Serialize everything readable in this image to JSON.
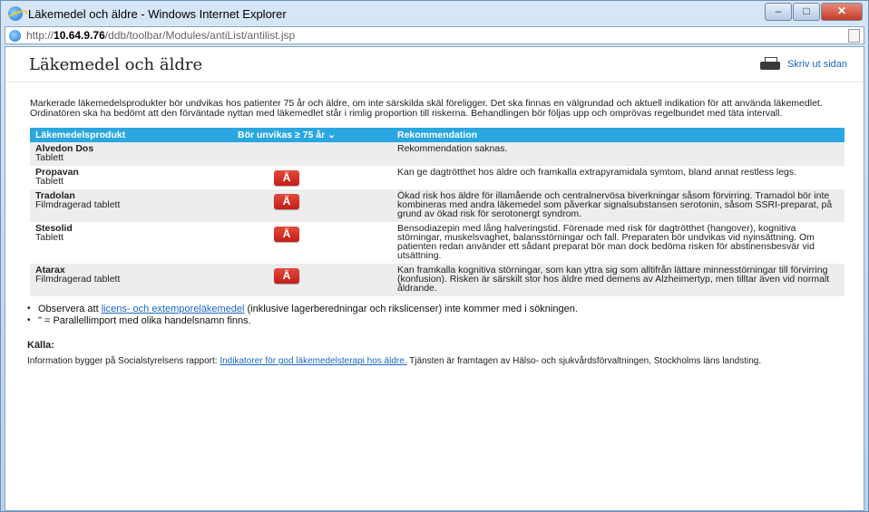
{
  "window": {
    "title": "Läkemedel och äldre - Windows Internet Explorer",
    "minimize": "–",
    "maximize": "□",
    "close": "✕"
  },
  "address": {
    "prefix": "http://",
    "host": "10.64.9.76",
    "path": "/ddb/toolbar/Modules/antiList/antilist.jsp"
  },
  "page": {
    "title": "Läkemedel och äldre",
    "print_label": "Skriv ut sidan",
    "intro": "Markerade läkemedelsprodukter bör undvikas hos patienter 75 år och äldre, om inte särskilda skäl föreligger. Det ska finnas en välgrundad och aktuell indikation för att använda läkemedlet. Ordinatören ska ha bedömt att den förväntade nyttan med läkemedlet står i rimlig proportion till riskerna. Behandlingen bör följas upp och omprövas regelbundet med täta intervall."
  },
  "table": {
    "headers": {
      "product": "Läkemedelsprodukt",
      "avoid": "Bör unvikas ≥ 75 år ⌄",
      "recommendation": "Rekommendation"
    },
    "warning_icon": "Ä",
    "rows": [
      {
        "name": "Alvedon Dos",
        "form": "Tablett",
        "avoid": false,
        "rec": "Rekommendation saknas."
      },
      {
        "name": "Propavan",
        "form": "Tablett",
        "avoid": true,
        "rec": "Kan ge dagtrötthet hos äldre och framkalla extrapyramidala symtom, bland annat restless legs."
      },
      {
        "name": "Tradolan",
        "form": "Filmdragerad tablett",
        "avoid": true,
        "rec": "Ökad risk hos äldre för illamående och centralnervösa biverkningar såsom förvirring. Tramadol bör inte kombineras med andra läkemedel som påverkar signalsubstansen serotonin, såsom SSRI-preparat, på grund av ökad risk för serotonergt syndrom."
      },
      {
        "name": "Stesolid",
        "form": "Tablett",
        "avoid": true,
        "rec": "Bensodiazepin med lång halveringstid. Förenade med risk för dagtrötthet (hangover), kognitiva störningar, muskelsvaghet, balansstörningar och fall. Preparaten bör undvikas vid nyinsättning. Om patienten redan använder ett sådant preparat bör man dock bedöma risken för abstinensbesvär vid utsättning."
      },
      {
        "name": "Atarax",
        "form": "Filmdragerad tablett",
        "avoid": true,
        "rec": "Kan framkalla kognitiva störningar, som kan yttra sig som alltifrån lättare minnesstörningar till förvirring (konfusion). Risken är särskilt stor hos äldre med demens av Alzheimertyp, men tilltar även vid normalt åldrande."
      }
    ]
  },
  "notes": {
    "note1_pre": "Observera att ",
    "note1_link": "licens- och extemporeläkemedel",
    "note1_post": " (inklusive lagerberedningar och rikslicenser) inte kommer med i sökningen.",
    "note2": "\" = Parallellimport med olika handelsnamn finns."
  },
  "source": {
    "title": "Källa:",
    "pre": "Information bygger på Socialstyrelsens rapport: ",
    "link": "Indikatorer för god läkemedelsterapi hos äldre.",
    "post": " Tjänsten är framtagen av Hälso- och sjukvårdsförvaltningen, Stockholms läns landsting."
  },
  "colors": {
    "header_bg": "#2aa7e0",
    "warning": "#d9332a",
    "link": "#1a66c2",
    "row_alt": "#ededed"
  }
}
